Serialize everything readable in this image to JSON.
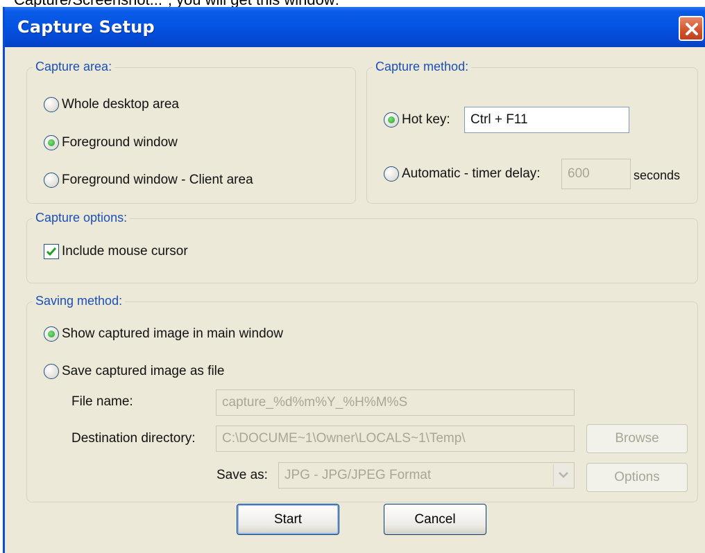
{
  "caption": "Capture/Screenshot...\", you will get this window:",
  "window": {
    "title": "Capture Setup"
  },
  "capture_area": {
    "legend": "Capture area:",
    "options": [
      {
        "label": "Whole desktop area",
        "selected": false
      },
      {
        "label": "Foreground window",
        "selected": true
      },
      {
        "label": "Foreground window - Client area",
        "selected": false
      }
    ]
  },
  "capture_method": {
    "legend": "Capture method:",
    "hotkey_label": "Hot key:",
    "hotkey_value": "Ctrl + F11",
    "hotkey_selected": true,
    "auto_label": "Automatic - timer delay:",
    "auto_value": "600",
    "auto_unit": "seconds",
    "auto_selected": false
  },
  "capture_options": {
    "legend": "Capture options:",
    "include_cursor_label": "Include mouse cursor",
    "include_cursor_checked": true
  },
  "saving_method": {
    "legend": "Saving method:",
    "show_main_label": "Show captured image in main window",
    "show_main_selected": true,
    "save_file_label": "Save captured image as file",
    "save_file_selected": false,
    "file_name_label": "File name:",
    "file_name_value": "capture_%d%m%Y_%H%M%S",
    "dest_label": "Destination directory:",
    "dest_value": "C:\\DOCUME~1\\Owner\\LOCALS~1\\Temp\\",
    "browse_label": "Browse",
    "save_as_label": "Save as:",
    "save_as_value": "JPG - JPG/JPEG Format",
    "options_label": "Options"
  },
  "buttons": {
    "start": "Start",
    "cancel": "Cancel"
  },
  "colors": {
    "titlebar": "#0553e2",
    "dialog_bg": "#ece9d8",
    "legend_text": "#1b4fb6",
    "radio_dot": "#21a121"
  }
}
